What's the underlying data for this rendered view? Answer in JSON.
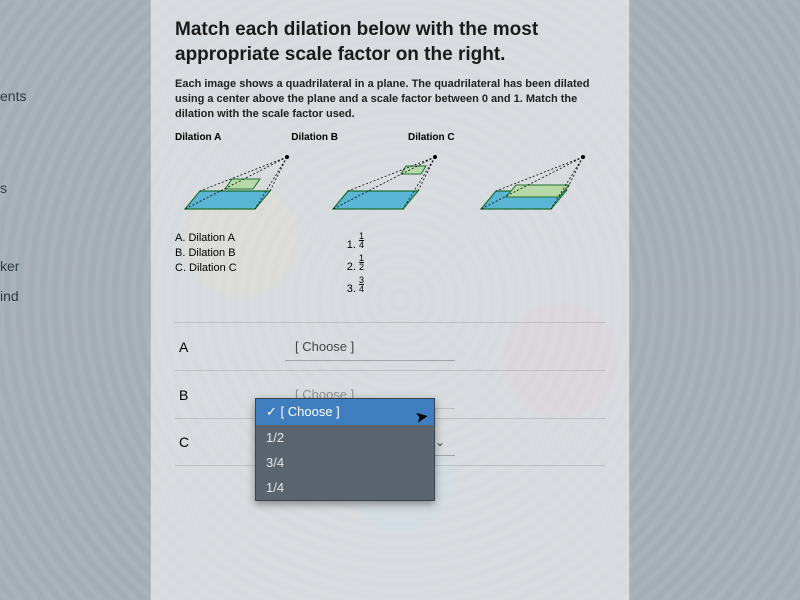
{
  "sidebar": {
    "frag1": "ents",
    "frag2": "s",
    "frag3": "ker",
    "frag4": "ind"
  },
  "title_line1": "Match each dilation below with the most",
  "title_line2": "appropriate scale factor on the right.",
  "instructions": "Each image shows a quadrilateral in a plane. The quadrilateral has been dilated using a center above the plane and a scale factor between 0 and 1. Match the dilation with the scale factor used.",
  "col_labels": {
    "a": "Dilation A",
    "b": "Dilation B",
    "c": "Dilation C"
  },
  "left_list": {
    "a": "A. Dilation A",
    "b": "B. Dilation B",
    "c": "C. Dilation C"
  },
  "right_list": {
    "r1_num": "1",
    "r1_n": "1",
    "r1_d": "4",
    "r2_num": "2",
    "r2_n": "1",
    "r2_d": "2",
    "r3_num": "3",
    "r3_n": "3",
    "r3_d": "4"
  },
  "match": {
    "a": "A",
    "b": "B",
    "c": "C"
  },
  "chooser": {
    "placeholder": "[ Choose ]",
    "collapsed_b": "[ Choose ]",
    "options": [
      "[ Choose ]",
      "1/2",
      "3/4",
      "1/4"
    ]
  }
}
